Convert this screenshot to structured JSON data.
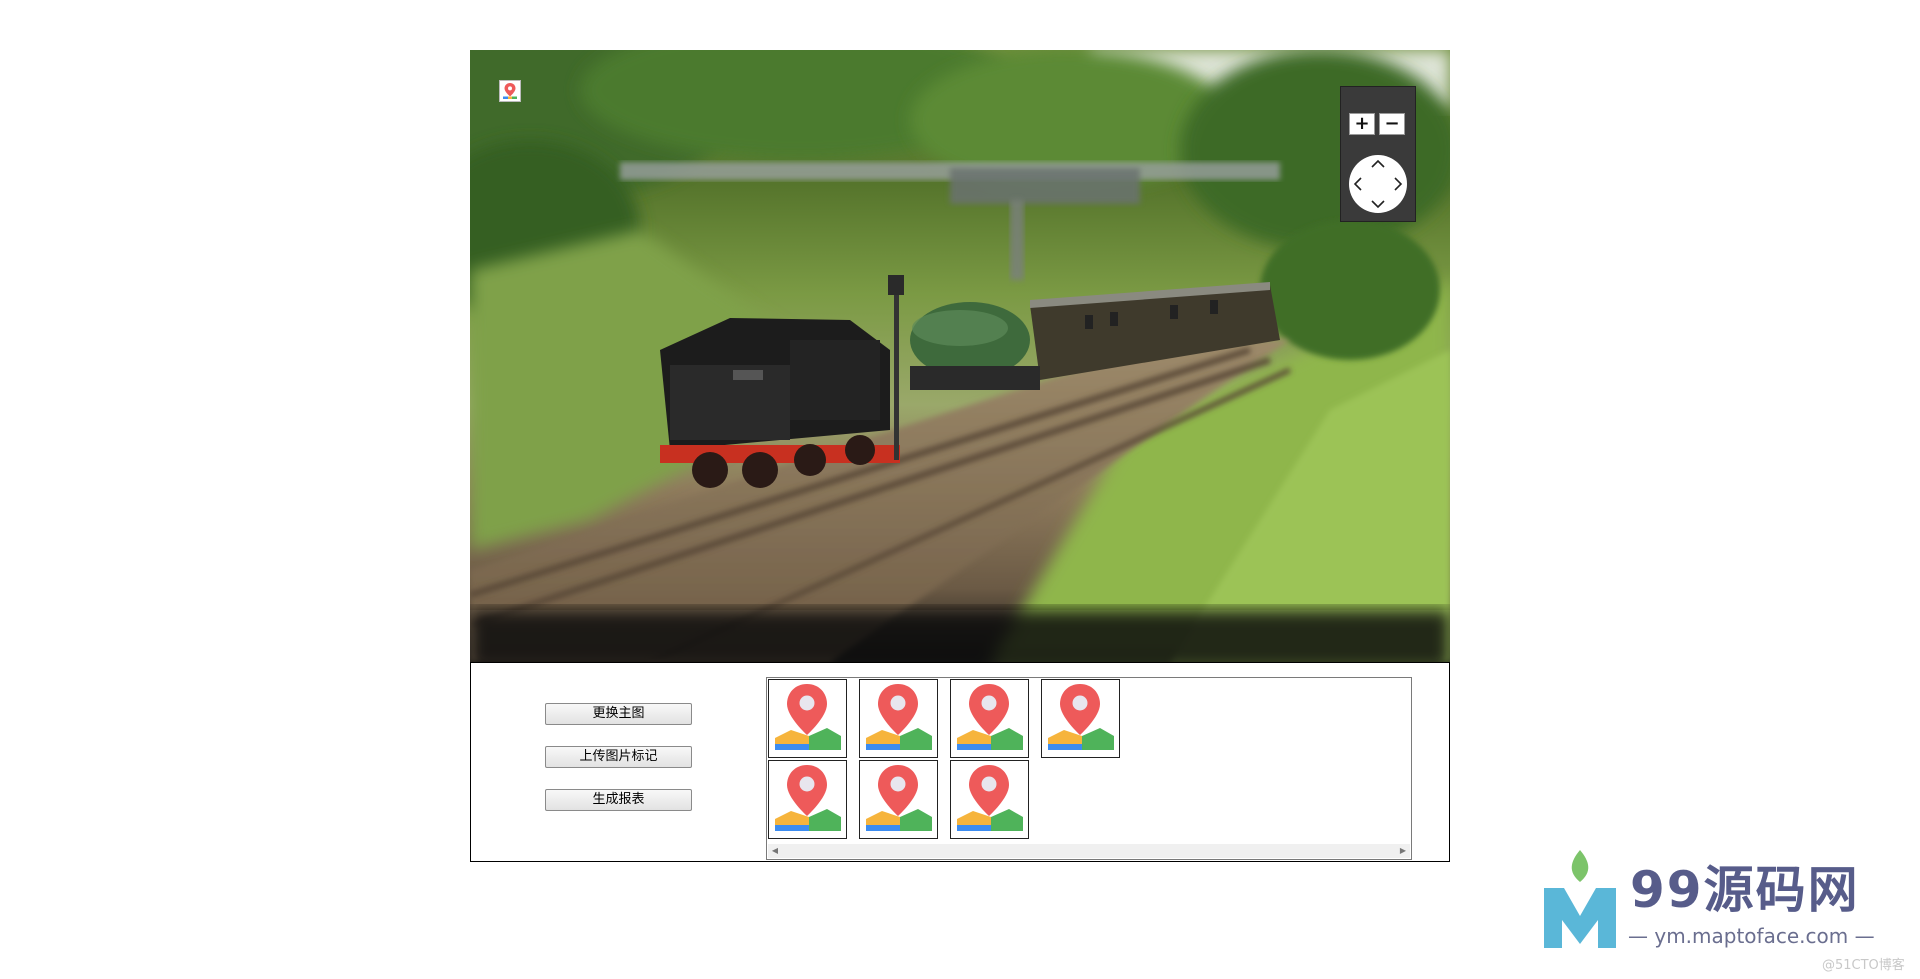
{
  "viewer": {
    "photo_subject": "steam-train-photo",
    "marker_icon": "map-pin-icon",
    "zoom_in_label": "+",
    "zoom_out_label": "−"
  },
  "actions": {
    "change_main_label": "更换主图",
    "upload_mark_label": "上传图片标记",
    "generate_report_label": "生成报表"
  },
  "thumbnails": {
    "icon": "map-location-icon",
    "count": 7
  },
  "watermark": {
    "title": "99源码网",
    "url": "— ym.maptoface.com —",
    "credit": "@51CTO博客"
  },
  "colors": {
    "pin_red": "#ee5a5a",
    "map_orange": "#f6b43c",
    "map_blue": "#3c8cf0",
    "map_green": "#4fb35a",
    "watermark_purple": "#575c8a",
    "watermark_teal": "#5ab7d8"
  }
}
